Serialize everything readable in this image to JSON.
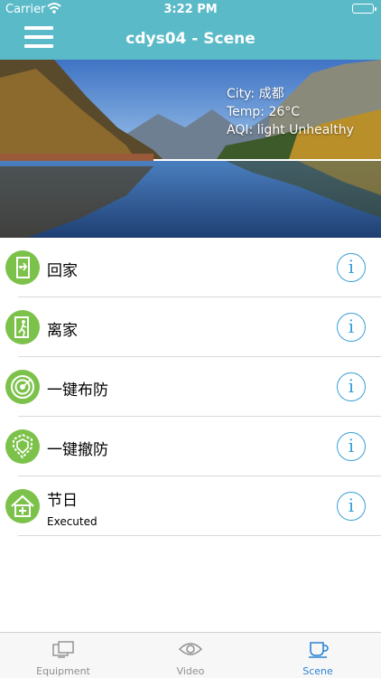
{
  "status_bar": {
    "carrier": "Carrier",
    "time": "3:22 PM",
    "battery_level": 1.0
  },
  "nav": {
    "title": "cdys04 - Scene",
    "menu_icon": "hamburger-menu-icon"
  },
  "weather": {
    "city": "City: 成都",
    "temp": "Temp: 26°C",
    "aqi": "AQI: light Unhealthy"
  },
  "scenes": [
    {
      "name": "回家",
      "status": "",
      "icon": "door-enter-icon"
    },
    {
      "name": "离家",
      "status": "",
      "icon": "door-leave-icon"
    },
    {
      "name": "一键布防",
      "status": "",
      "icon": "arm-shield-icon"
    },
    {
      "name": "一键撤防",
      "status": "",
      "icon": "disarm-shield-icon"
    },
    {
      "name": "节日",
      "status": "Executed",
      "icon": "holiday-house-icon"
    }
  ],
  "info_label": "i",
  "tabs": [
    {
      "label": "Equipment",
      "icon": "equipment-icon",
      "active": false
    },
    {
      "label": "Video",
      "icon": "eye-icon",
      "active": false
    },
    {
      "label": "Scene",
      "icon": "cup-icon",
      "active": true
    }
  ],
  "colors": {
    "nav_background": "#5bbac8",
    "scene_icon_green": "#7cc24a",
    "info_blue": "#3a9fd4",
    "active_tab_blue": "#2a84d2"
  }
}
